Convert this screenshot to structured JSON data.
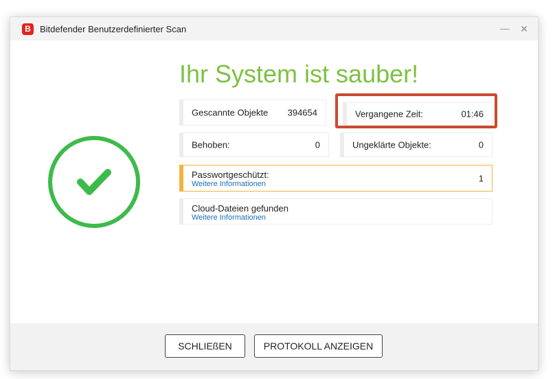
{
  "window": {
    "app_logo_letter": "B",
    "title": "Bitdefender Benutzerdefinierter Scan",
    "close_glyph": "✕"
  },
  "status": {
    "headline": "Ihr System ist sauber!",
    "icon": "check-circle-icon",
    "color": "#3dbb4a"
  },
  "stats": {
    "scanned": {
      "label": "Gescannte Objekte",
      "value": "394654"
    },
    "elapsed": {
      "label": "Vergangene Zeit:",
      "value": "01:46"
    },
    "fixed": {
      "label": "Behoben:",
      "value": "0"
    },
    "unresolved": {
      "label": "Ungeklärte Objekte:",
      "value": "0"
    }
  },
  "password_protected": {
    "label": "Passwortgeschützt:",
    "link": "Weitere Informationen",
    "value": "1",
    "accent_color": "#f2b33d"
  },
  "cloud_files": {
    "label": "Cloud-Dateien gefunden",
    "link": "Weitere Informationen"
  },
  "footer": {
    "close_label": "SCHLIEßEN",
    "log_label": "PROTOKOLL ANZEIGEN"
  },
  "colors": {
    "headline": "#7cc142",
    "highlight": "#c84b32",
    "link": "#1a6fb5",
    "brand_red": "#e2231a"
  }
}
